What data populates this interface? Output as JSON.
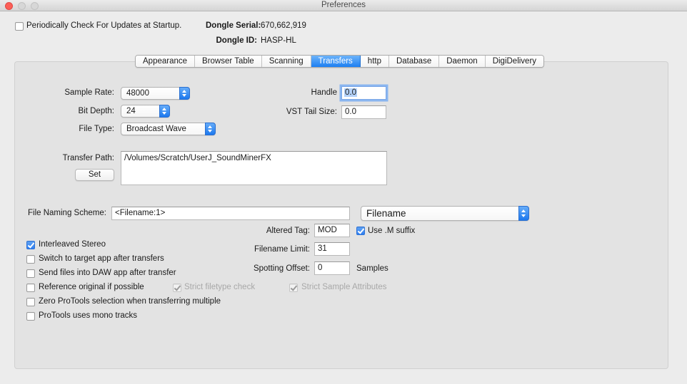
{
  "window": {
    "title": "Preferences"
  },
  "top": {
    "check_updates_label": "Periodically Check For Updates at Startup.",
    "check_updates_checked": false,
    "dongle_serial_label": "Dongle Serial:",
    "dongle_serial_value": "670,662,919",
    "dongle_id_label": "Dongle ID:",
    "dongle_id_value": "HASP-HL"
  },
  "tabs": [
    "Appearance",
    "Browser Table",
    "Scanning",
    "Transfers",
    "http",
    "Database",
    "Daemon",
    "DigiDelivery"
  ],
  "active_tab": "Transfers",
  "transfers": {
    "sample_rate_label": "Sample Rate:",
    "sample_rate_value": "48000",
    "bit_depth_label": "Bit Depth:",
    "bit_depth_value": "24",
    "file_type_label": "File Type:",
    "file_type_value": "Broadcast Wave",
    "handle_label": "Handle",
    "handle_value": "0.0",
    "vst_tail_label": "VST Tail Size:",
    "vst_tail_value": "0.0",
    "transfer_path_label": "Transfer Path:",
    "transfer_path_value": "/Volumes/Scratch/UserJ_SoundMinerFX",
    "set_button": "Set",
    "naming_scheme_label": "File Naming Scheme:",
    "naming_scheme_value": "<Filename:1>",
    "naming_popup_value": "Filename",
    "altered_tag_label": "Altered Tag:",
    "altered_tag_value": "MOD",
    "use_m_suffix_label": "Use .M suffix",
    "filename_limit_label": "Filename Limit:",
    "filename_limit_value": "31",
    "spotting_offset_label": "Spotting Offset:",
    "spotting_offset_value": "0",
    "spotting_offset_unit": "Samples",
    "strict_filetype_label": "Strict filetype check",
    "strict_sample_label": "Strict Sample Attributes",
    "options": [
      {
        "label": "Interleaved Stereo",
        "checked": true
      },
      {
        "label": "Switch to target app after transfers",
        "checked": false
      },
      {
        "label": "Send files into DAW app after transfer",
        "checked": false
      },
      {
        "label": "Reference original if possible",
        "checked": false
      },
      {
        "label": "Zero ProTools selection when transferring multiple",
        "checked": false
      },
      {
        "label": "ProTools uses mono tracks",
        "checked": false
      }
    ]
  },
  "colors": {
    "accent": "#1d7ff2",
    "close": "#fc5f57"
  }
}
